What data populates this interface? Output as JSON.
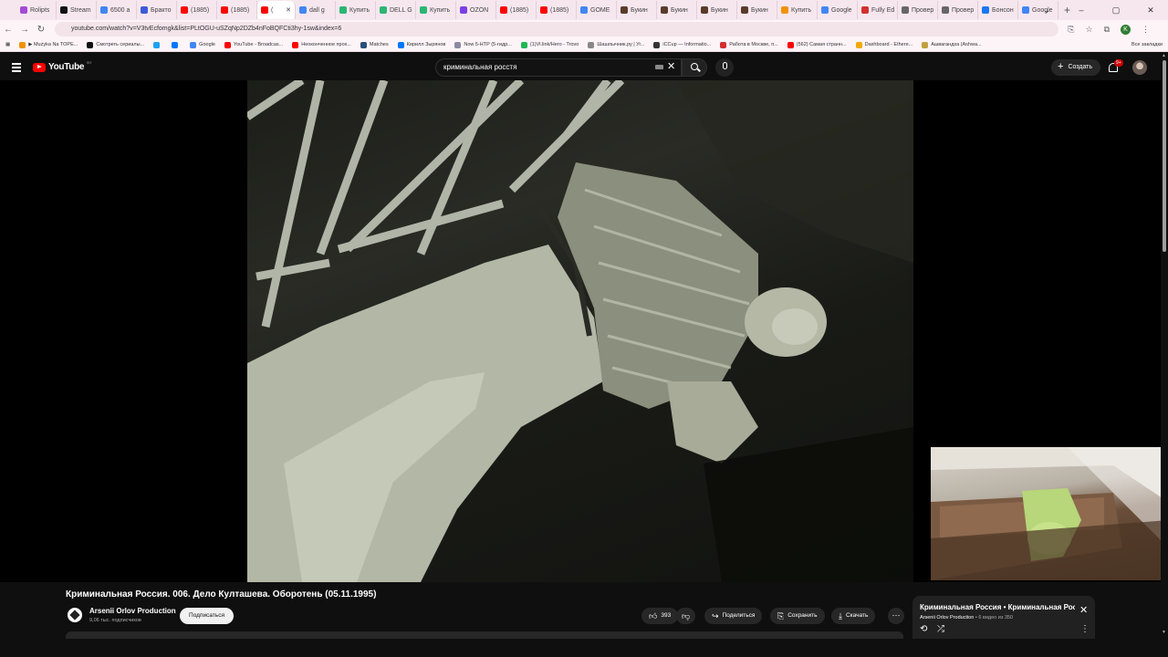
{
  "browser": {
    "tabs": [
      {
        "label": "Rolipts",
        "color": "#a34bd6"
      },
      {
        "label": "Stream",
        "color": "#111111"
      },
      {
        "label": "6500 a",
        "color": "#4285f4"
      },
      {
        "label": "Бракто",
        "color": "#3c5bd6"
      },
      {
        "label": "(1885)",
        "color": "#ff0000"
      },
      {
        "label": "(1885)",
        "color": "#ff0000"
      },
      {
        "label": "(",
        "color": "#ff0000",
        "active": true
      },
      {
        "label": "dall g",
        "color": "#4285f4"
      },
      {
        "label": "Купить",
        "color": "#2bb673"
      },
      {
        "label": "DELL G",
        "color": "#2bb673"
      },
      {
        "label": "Купить",
        "color": "#2bb673"
      },
      {
        "label": "OZON",
        "color": "#7b3fe4"
      },
      {
        "label": "(1885)",
        "color": "#ff0000"
      },
      {
        "label": "(1885)",
        "color": "#ff0000"
      },
      {
        "label": "GOME",
        "color": "#4285f4"
      },
      {
        "label": "Букин",
        "color": "#5a3b2a"
      },
      {
        "label": "Букин",
        "color": "#5a3b2a"
      },
      {
        "label": "Букин",
        "color": "#5a3b2a"
      },
      {
        "label": "Букин",
        "color": "#5a3b2a"
      },
      {
        "label": "Купить",
        "color": "#f29100"
      },
      {
        "label": "Google",
        "color": "#4285f4"
      },
      {
        "label": "Fully Ed",
        "color": "#d32f2f"
      },
      {
        "label": "Провер",
        "color": "#666666"
      },
      {
        "label": "Провер",
        "color": "#666666"
      },
      {
        "label": "Бонсон",
        "color": "#1877f2"
      },
      {
        "label": "Google",
        "color": "#4285f4"
      }
    ],
    "url": "youtube.com/watch?v=V3tvEcfomgk&list=PLtOGU-uSZqNp2DZb4nFoBQFCti3hy-1sw&index=6",
    "profile_initial": "K",
    "bookmarks": [
      {
        "label": "▶ Muzyka Na TOPE...",
        "color": "#f29100"
      },
      {
        "label": "Смотреть сериалы...",
        "color": "#111111"
      },
      {
        "label": "",
        "color": "#1da1f2"
      },
      {
        "label": "",
        "color": "#0077ff"
      },
      {
        "label": "Google",
        "color": "#4285f4"
      },
      {
        "label": "YouTube - Broadcas...",
        "color": "#ff0000"
      },
      {
        "label": "Неоконченное прох...",
        "color": "#ff0000"
      },
      {
        "label": "Matches",
        "color": "#2a4d7a"
      },
      {
        "label": "Кирилл Зырянов",
        "color": "#0077ff"
      },
      {
        "label": "Now 5-HTP (5-гидр...",
        "color": "#8a8aa0"
      },
      {
        "label": "(1)Vl.link/Hero - Trovo",
        "color": "#1db954"
      },
      {
        "label": "Шашлычник.ру | Уг...",
        "color": "#888888"
      },
      {
        "label": "iCCup — Informatio...",
        "color": "#333333"
      },
      {
        "label": "Работа в Москве, п...",
        "color": "#d32f2f"
      },
      {
        "label": "(562) Самая странн...",
        "color": "#ff0000"
      },
      {
        "label": "Dashboard - Ethere...",
        "color": "#f2a900"
      },
      {
        "label": "Ашвагандха (Ashwa...",
        "color": "#c0a040"
      }
    ],
    "bookmarks_all": "Все закладки"
  },
  "youtube": {
    "logo_text": "YouTube",
    "region": "BY",
    "search_value": "криминальная росстя",
    "create_label": "Создать",
    "notif_count": "9+",
    "video": {
      "title": "Криминальная Россия. 006. Дело Култашева. Оборотень (05.11.1995)",
      "channel": "Arsenii Orlov Production",
      "subscribers": "9,06 тыс. подписчиков",
      "subscribe_label": "Подписаться",
      "likes": "393",
      "share_label": "Поделиться",
      "save_label": "Сохранить",
      "download_label": "Скачать"
    },
    "playlist": {
      "title": "Криминальная Россия • Криминальная Россия",
      "channel": "Arsenii Orlov Production",
      "position": "6 видео из 350"
    }
  }
}
